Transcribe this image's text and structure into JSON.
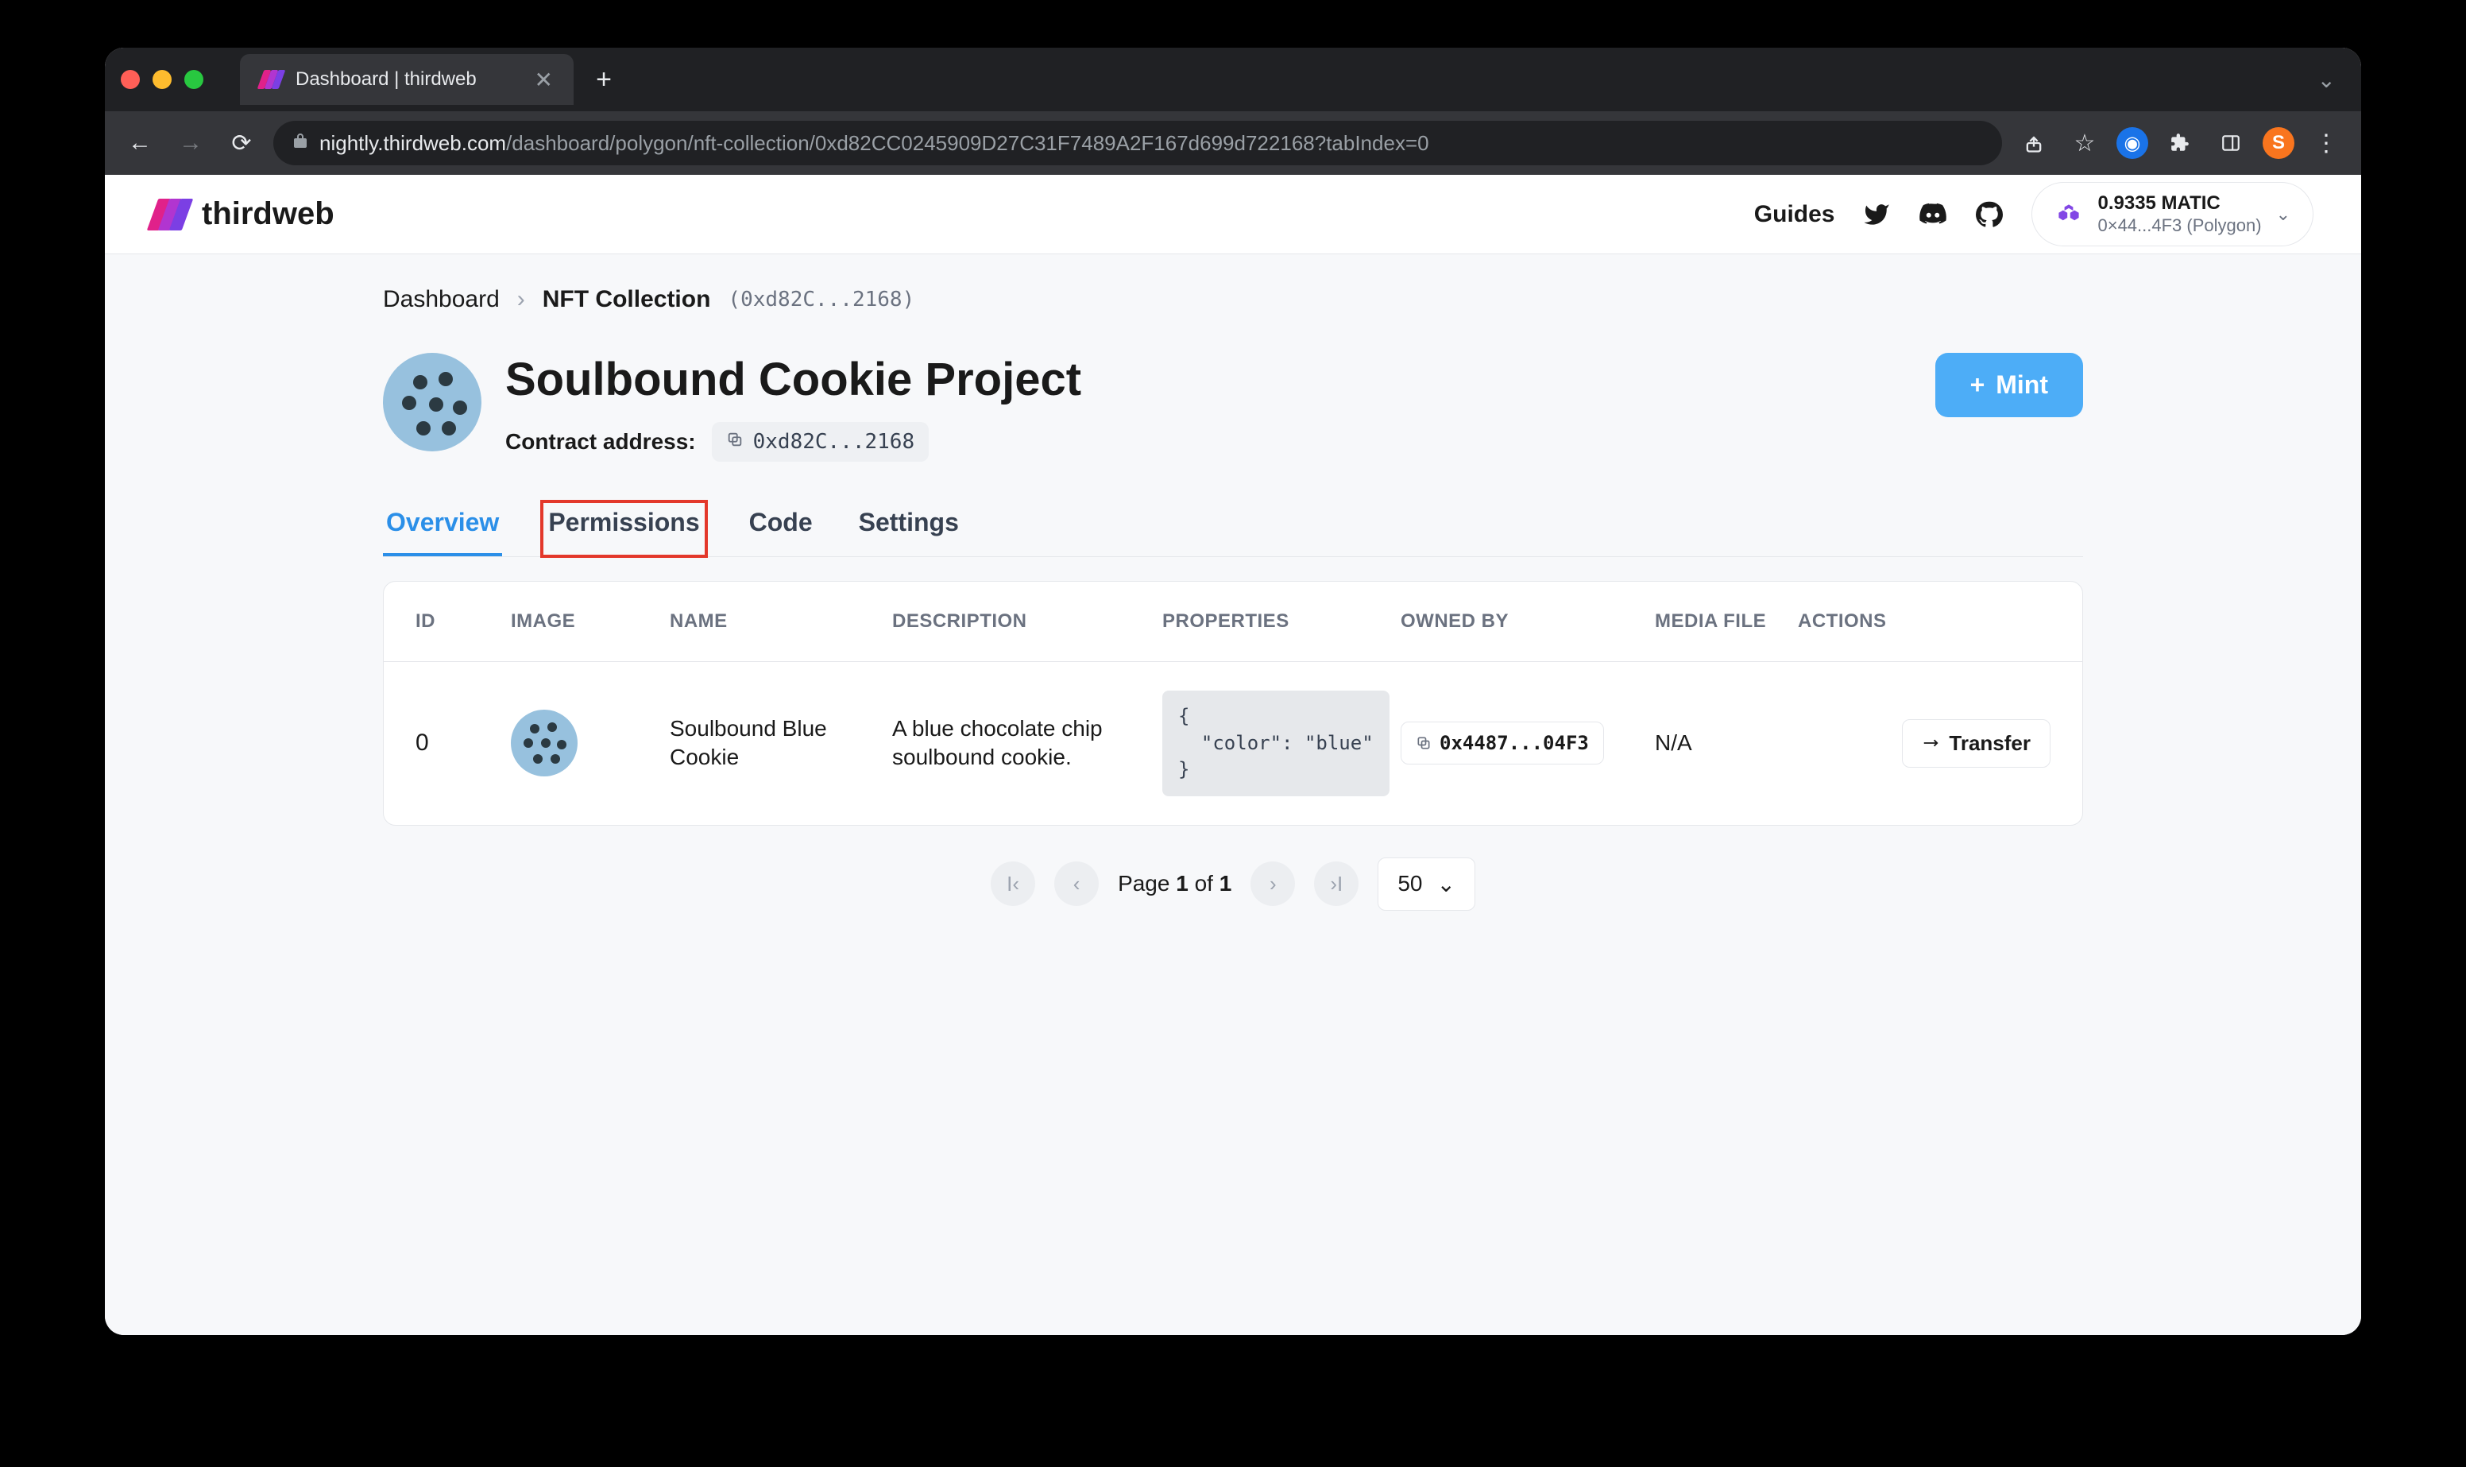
{
  "browser": {
    "tab_title": "Dashboard | thirdweb",
    "url_host": "nightly.thirdweb.com",
    "url_path": "/dashboard/polygon/nft-collection/0xd82CC0245909D27C31F7489A2F167d699d722168?tabIndex=0",
    "profile_initial": "S"
  },
  "header": {
    "brand": "thirdweb",
    "guides": "Guides",
    "wallet": {
      "balance": "0.9335 MATIC",
      "address": "0×44...4F3 (Polygon)"
    }
  },
  "breadcrumb": {
    "root": "Dashboard",
    "current": "NFT Collection",
    "addr": "(0xd82C...2168)"
  },
  "project": {
    "title": "Soulbound Cookie Project",
    "contract_label": "Contract address:",
    "contract_addr": "0xd82C...2168",
    "mint_label": "Mint"
  },
  "tabs": [
    {
      "label": "Overview",
      "active": true,
      "highlighted": false
    },
    {
      "label": "Permissions",
      "active": false,
      "highlighted": true
    },
    {
      "label": "Code",
      "active": false,
      "highlighted": false
    },
    {
      "label": "Settings",
      "active": false,
      "highlighted": false
    }
  ],
  "table": {
    "columns": [
      "ID",
      "IMAGE",
      "NAME",
      "DESCRIPTION",
      "PROPERTIES",
      "OWNED BY",
      "MEDIA FILE",
      "ACTIONS"
    ],
    "rows": [
      {
        "id": "0",
        "name": "Soulbound Blue Cookie",
        "description": "A blue chocolate chip soulbound cookie.",
        "properties_lines": [
          "{",
          "  \"color\": \"blue\"",
          "}"
        ],
        "owned_by": "0x4487...04F3",
        "media": "N/A",
        "action_label": "Transfer"
      }
    ]
  },
  "pagination": {
    "prefix": "Page ",
    "current": "1",
    "of": " of ",
    "total": "1",
    "page_size": "50"
  }
}
